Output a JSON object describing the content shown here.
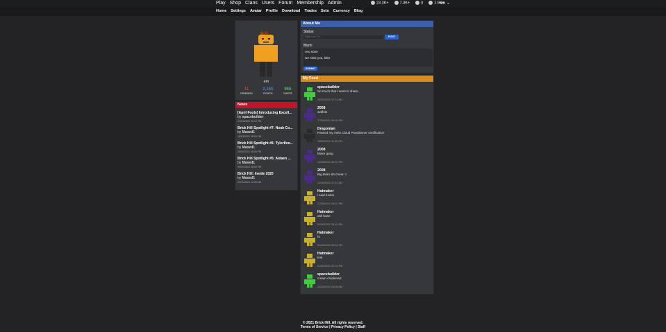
{
  "nav": {
    "items": [
      "Play",
      "Shop",
      "Clans",
      "Users",
      "Forum",
      "Membership",
      "Admin"
    ]
  },
  "stats": {
    "currency1": "23.3K+",
    "currency2": "7.3K+",
    "messages": "0",
    "friends": "1.9K+"
  },
  "user": {
    "name": "em"
  },
  "subnav": {
    "items": [
      "Home",
      "Settings",
      "Avatar",
      "Profile",
      "Download",
      "Trades",
      "Sets",
      "Currency",
      "Blog"
    ]
  },
  "profile": {
    "username": "em",
    "friends": {
      "value": "11",
      "label": "FRIENDS",
      "color": "#d9342f"
    },
    "posts": {
      "value": "2,165",
      "label": "POSTS",
      "color": "#3d7fe0"
    },
    "visits": {
      "value": "965",
      "label": "VISITS",
      "color": "#3dbf5a"
    }
  },
  "news": {
    "title": "News",
    "items": [
      {
        "title": "[April Fools] Introducing Excell...",
        "by": "by",
        "author": "spacebuilder",
        "date": "01/04/2021 03:12 PM"
      },
      {
        "title": "Brick Hill Spotlight #7: Noah Co...",
        "by": "by",
        "author": "Maxed1",
        "date": "16/03/2021 08:00 PM"
      },
      {
        "title": "Brick Hill Spotlight #6: Tylorfloo...",
        "by": "by",
        "author": "Maxed1",
        "date": "26/02/2021 08:00 PM"
      },
      {
        "title": "Brick Hill Spotlight #5: Aidaen ...",
        "by": "by",
        "author": "Maxed1",
        "date": "09/02/2021 08:00 PM"
      },
      {
        "title": "Brick Hill: Inside 2020",
        "by": "by",
        "author": "Maxed1",
        "date": "01/01/2021 12:00 AM"
      }
    ]
  },
  "about": {
    "title": "About Me",
    "status_label": "Status:",
    "status_placeholder": "Right now I'm...",
    "post_button": "POST",
    "blurb_label": "Blurb:",
    "blurb_line1": "ceo soon",
    "blurb_line2": "we miss you, luke",
    "submit_button": "SUBMIT"
  },
  "feed": {
    "title": "My Feed",
    "items": [
      {
        "user": "spacebuilder",
        "message": "So much that I want to share.",
        "time": "20/05/2021 07:13 AM",
        "avatar": "green"
      },
      {
        "user": "2008",
        "message": "waffels",
        "time": "17/06/2021 06:05 PM",
        "avatar": "purple"
      },
      {
        "user": "Dragonian",
        "message": "Passed my AWS Cloud Practitioner certification",
        "time": "15/06/2021 11:06 PM",
        "avatar": "dark"
      },
      {
        "user": "2008",
        "message": "Muke gang",
        "time": "12/06/2021 09:32 PM",
        "avatar": "purple"
      },
      {
        "user": "2008",
        "message": "Big Boko da Great :c",
        "time": "12/06/2021 07:47 AM",
        "avatar": "purple"
      },
      {
        "user": "Hatmaker",
        "message": "i said funkin",
        "time": "17/06/2021 04:37 PM",
        "avatar": "yellow"
      },
      {
        "user": "Hatmaker",
        "message": "doll base",
        "time": "01/06/2021 03:19 PM",
        "avatar": "yellow"
      },
      {
        "user": "Hatmaker",
        "message": "hi",
        "time": "01/06/2021 04:54 PM",
        "avatar": "yellow"
      },
      {
        "user": "Hatmaker",
        "message": "test",
        "time": "01/06/2021 02:10 PM",
        "avatar": "yellow"
      },
      {
        "user": "spacebuilder",
        "message": "cream-crackered",
        "time": "20/05/2021 04:08 AM",
        "avatar": "green"
      }
    ]
  },
  "footer": {
    "copyright": "© 2021 Brick Hill. All rights reserved.",
    "links": "Terms of Service | Privacy Policy | Staff"
  }
}
